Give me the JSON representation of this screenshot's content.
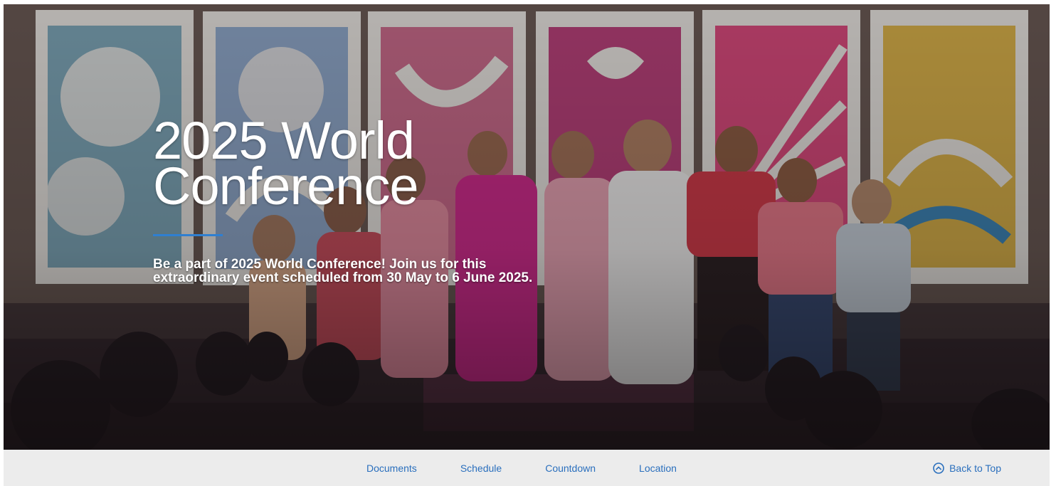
{
  "hero": {
    "title_line1": "2025 World",
    "title_line2": "Conference",
    "description": "Be a part of 2025 World Conference! Join us for this extraordinary event scheduled from 30 May to 6 June 2025.",
    "photo_icon": "conference-choir-photo"
  },
  "subnav": {
    "links": [
      {
        "label": "Documents"
      },
      {
        "label": "Schedule"
      },
      {
        "label": "Countdown"
      },
      {
        "label": "Location"
      }
    ],
    "back_to_top": {
      "label": "Back to Top",
      "icon": "chevron-up-circle-icon"
    }
  },
  "colors": {
    "accent_rule": "#2f7fd1",
    "link": "#2a6fbd",
    "nav_background": "#ececec"
  }
}
